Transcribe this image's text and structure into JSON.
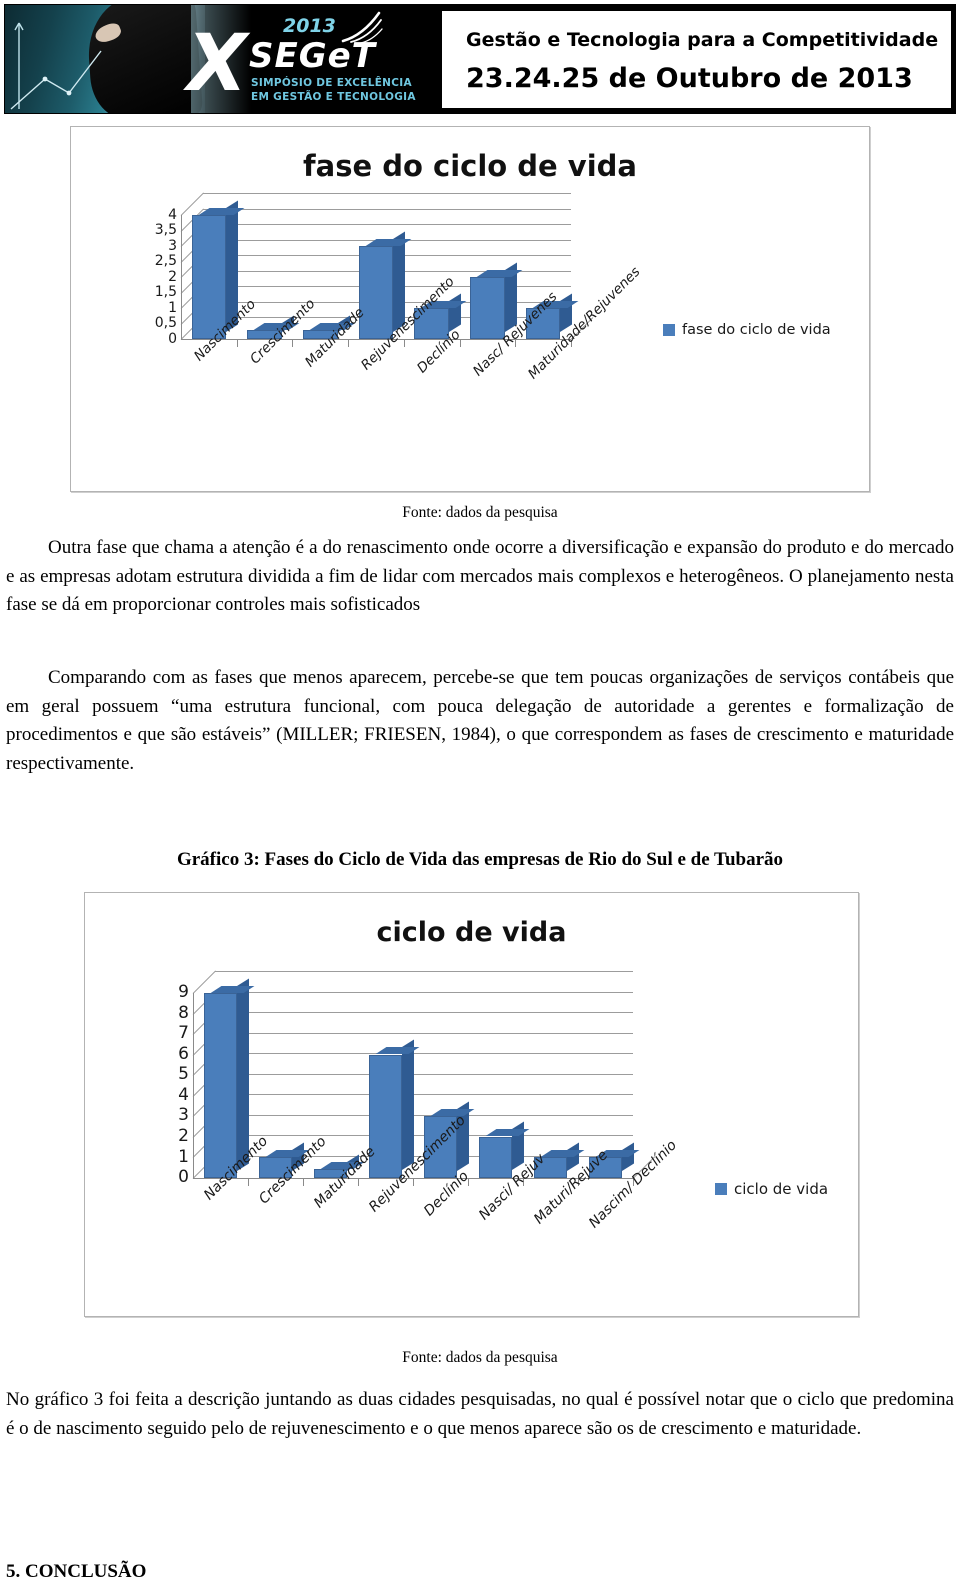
{
  "header": {
    "logo": {
      "year": "2013",
      "x_mark": "X",
      "acronym": "SEGeT",
      "subtitle_line1": "SIMPÓSIO DE EXCELÊNCIA",
      "subtitle_line2": "EM GESTÃO E TECNOLOGIA"
    },
    "title": "Gestão e Tecnologia para a Competitividade",
    "dates": "23.24.25 de Outubro de 2013"
  },
  "chart_data": [
    {
      "type": "bar",
      "title": "fase do ciclo de vida",
      "categories": [
        "Nascimento",
        "Crescimento",
        "Maturidade",
        "Rejuvenescimento",
        "Declínio",
        "Nasc/ Rejuvenes",
        "Maturidade/Rejuvenes"
      ],
      "values": [
        4,
        0,
        0,
        3,
        1,
        2,
        1
      ],
      "legend": [
        "fase do ciclo de vida"
      ],
      "legend_position": "right",
      "ylim": [
        0,
        4
      ],
      "yticks": [
        "0",
        "0,5",
        "1",
        "1,5",
        "2",
        "2,5",
        "3",
        "3,5",
        "4"
      ],
      "xlabel": "",
      "ylabel": "",
      "grid": true,
      "series_color": "#4a7ebb"
    },
    {
      "type": "bar",
      "title": "ciclo de vida",
      "categories": [
        "Nascimento",
        "Crescimento",
        "Maturidade",
        "Rejuvenescimento",
        "Declínio",
        "Nasci/ Rejuv",
        "Maturi/Rejuve",
        "Nascim/ Declínio"
      ],
      "values": [
        9,
        1,
        0,
        6,
        3,
        2,
        1,
        1
      ],
      "legend": [
        "ciclo de vida"
      ],
      "legend_position": "right",
      "ylim": [
        0,
        9
      ],
      "yticks": [
        "0",
        "1",
        "2",
        "3",
        "4",
        "5",
        "6",
        "7",
        "8",
        "9"
      ],
      "xlabel": "",
      "ylabel": "",
      "grid": true,
      "series_color": "#4a7ebb"
    }
  ],
  "body": {
    "fonte1": "Fonte: dados da pesquisa",
    "para1": "Outra fase que chama a atenção é a do renascimento onde ocorre a diversificação e expansão do produto e do mercado e as empresas adotam estrutura dividida a fim de lidar com mercados mais complexos e heterogêneos. O planejamento nesta fase se dá em proporcionar controles mais sofisticados",
    "para2": "Comparando com as fases que menos aparecem, percebe-se que tem poucas organizações de serviços contábeis que em geral possuem “uma estrutura funcional, com pouca delegação de autoridade a gerentes e formalização de procedimentos e que são estáveis” (MILLER; FRIESEN, 1984), o que correspondem as fases de crescimento e maturidade respectivamente.",
    "caption_grafico3": "Gráfico 3: Fases do Ciclo de Vida das empresas de Rio do Sul e de Tubarão",
    "fonte2": "Fonte: dados da pesquisa",
    "para3": "No gráfico 3 foi feita a descrição juntando as duas cidades pesquisadas, no qual é possível notar que o ciclo que predomina é o de nascimento seguido pelo de rejuvenescimento e o que menos aparece são os de crescimento e maturidade.",
    "conclusao_heading": "5.  CONCLUSÃO"
  }
}
